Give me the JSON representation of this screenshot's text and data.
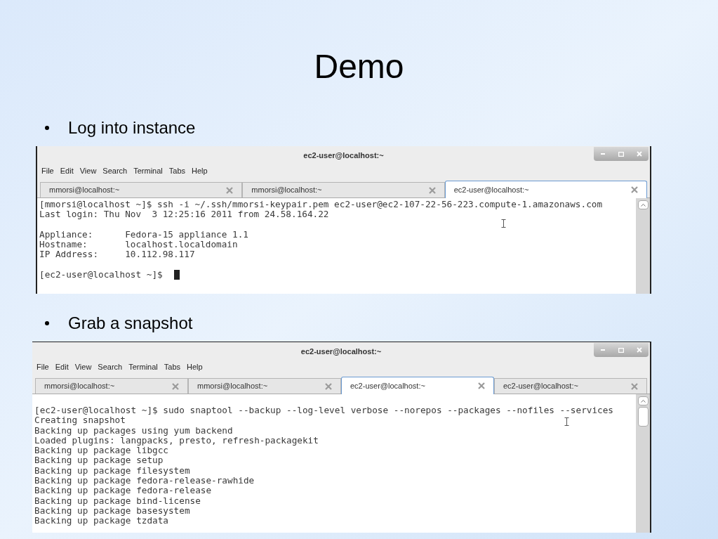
{
  "title": "Demo",
  "sections": [
    {
      "bullet": "Log into instance",
      "terminal": {
        "title": "ec2-user@localhost:~",
        "menu": [
          "File",
          "Edit",
          "View",
          "Search",
          "Terminal",
          "Tabs",
          "Help"
        ],
        "tabs": [
          {
            "label": "mmorsi@localhost:~",
            "selected": false
          },
          {
            "label": "mmorsi@localhost:~",
            "selected": false
          },
          {
            "label": "ec2-user@localhost:~",
            "selected": true
          }
        ],
        "cursor": true,
        "paragraphs": [
          [
            "[mmorsi@localhost ~]$ ssh -i ~/.ssh/mmorsi-keypair.pem ec2-user@ec2-107-22-56-223.compute-1.amazonaws.com",
            "Last login: Thu Nov  3 12:25:16 2011 from 24.58.164.22"
          ],
          [
            "Appliance:      Fedora-15 appliance 1.1",
            "Hostname:       localhost.localdomain",
            "IP Address:     10.112.98.117"
          ],
          [
            "[ec2-user@localhost ~]$"
          ]
        ]
      }
    },
    {
      "bullet": "Grab a snapshot",
      "terminal": {
        "title": "ec2-user@localhost:~",
        "menu": [
          "File",
          "Edit",
          "View",
          "Search",
          "Terminal",
          "Tabs",
          "Help"
        ],
        "tabs": [
          {
            "label": "mmorsi@localhost:~",
            "selected": false
          },
          {
            "label": "mmorsi@localhost:~",
            "selected": false
          },
          {
            "label": "ec2-user@localhost:~",
            "selected": true
          },
          {
            "label": "ec2-user@localhost:~",
            "selected": false
          }
        ],
        "cursor": false,
        "paragraphs": [
          [
            "[ec2-user@localhost ~]$ sudo snaptool --backup --log-level verbose --norepos --packages --nofiles --services",
            "Creating snapshot",
            "Backing up packages using yum backend",
            "Loaded plugins: langpacks, presto, refresh-packagekit",
            "Backing up package libgcc",
            "Backing up package setup",
            "Backing up package filesystem",
            "Backing up package fedora-release-rawhide",
            "Backing up package fedora-release",
            "Backing up package bind-license",
            "Backing up package basesystem",
            "Backing up package tzdata"
          ]
        ]
      }
    }
  ]
}
